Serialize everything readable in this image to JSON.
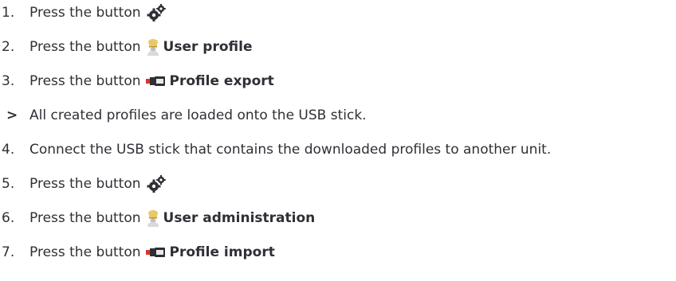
{
  "steps": [
    {
      "marker": "1.",
      "text": "Press the button",
      "icon": "gears-icon",
      "label": ""
    },
    {
      "marker": "2.",
      "text": "Press the button",
      "icon": "chef-user-icon",
      "label": "User profile"
    },
    {
      "marker": "3.",
      "text": "Press the button",
      "icon": "usb-export-icon",
      "label": "Profile export"
    },
    {
      "marker": ">",
      "text": "All created profiles are loaded onto the USB stick.",
      "icon": "",
      "label": ""
    },
    {
      "marker": "4.",
      "text": "Connect the USB stick that contains the downloaded profiles to another unit.",
      "icon": "",
      "label": ""
    },
    {
      "marker": "5.",
      "text": "Press the button",
      "icon": "gears-icon",
      "label": ""
    },
    {
      "marker": "6.",
      "text": "Press the button",
      "icon": "chef-user-icon",
      "label": "User administration"
    },
    {
      "marker": "7.",
      "text": "Press the button",
      "icon": "usb-import-icon",
      "label": "Profile import"
    }
  ],
  "colors": {
    "text": "#2f3036",
    "icon_dark": "#2f3036",
    "chef_hat": "#e8c96a",
    "usb_red": "#d9362b"
  }
}
